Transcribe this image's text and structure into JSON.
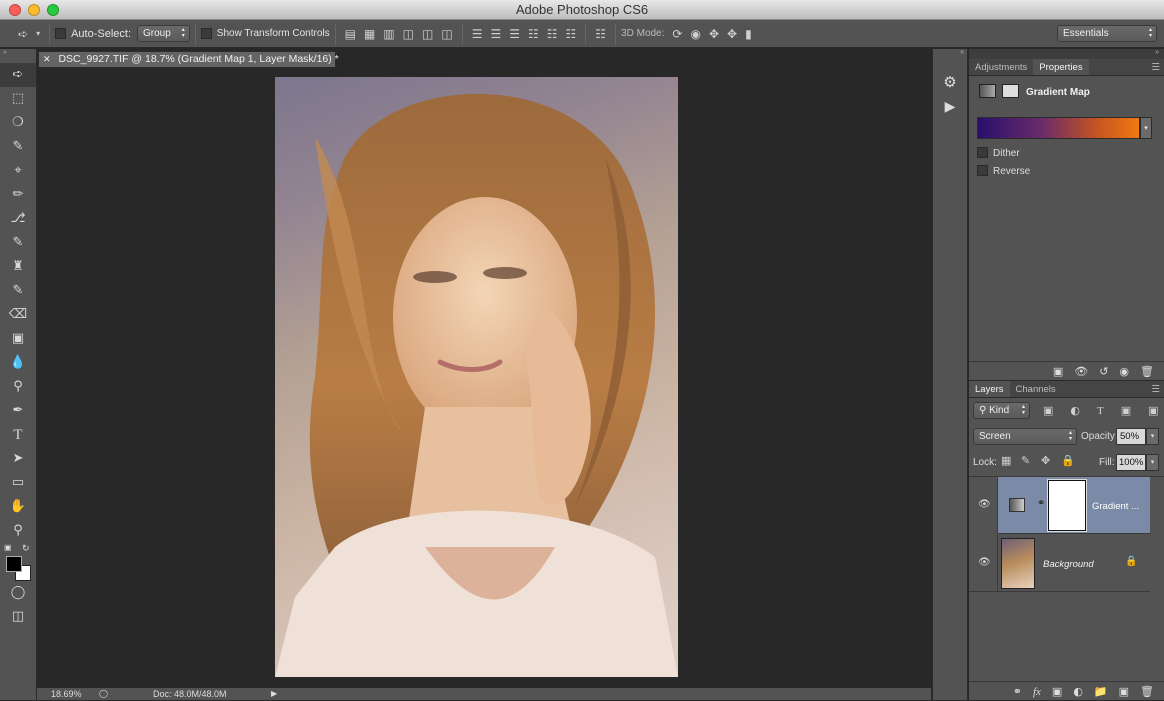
{
  "app": {
    "title": "Adobe Photoshop CS6"
  },
  "options_bar": {
    "auto_select_label": "Auto-Select:",
    "auto_select_value": "Group",
    "show_transform_label": "Show Transform Controls",
    "mode_3d_label": "3D Mode:",
    "workspace": "Essentials"
  },
  "document": {
    "tab_title": "DSC_9927.TIF @ 18.7% (Gradient Map 1, Layer Mask/16) *"
  },
  "status": {
    "zoom": "18.69%",
    "doc_size": "Doc: 48.0M/48.0M"
  },
  "properties_panel": {
    "tabs": [
      {
        "label": "Adjustments"
      },
      {
        "label": "Properties"
      }
    ],
    "title": "Gradient Map",
    "gradient_colors": [
      "#2a0f6e",
      "#f07a10"
    ],
    "dither_label": "Dither",
    "reverse_label": "Reverse"
  },
  "layers_panel": {
    "tabs": [
      {
        "label": "Layers"
      },
      {
        "label": "Channels"
      }
    ],
    "filter_kind": "Kind",
    "blend_mode": "Screen",
    "opacity_label": "Opacity:",
    "opacity_value": "50%",
    "lock_label": "Lock:",
    "fill_label": "Fill:",
    "fill_value": "100%",
    "layers": [
      {
        "name": "Gradient ...",
        "selected": true
      },
      {
        "name": "Background",
        "selected": false
      }
    ]
  },
  "colors": {
    "panel_bg": "#535353",
    "workspace_bg": "#282828",
    "selected_layer": "#7b8aa6"
  }
}
